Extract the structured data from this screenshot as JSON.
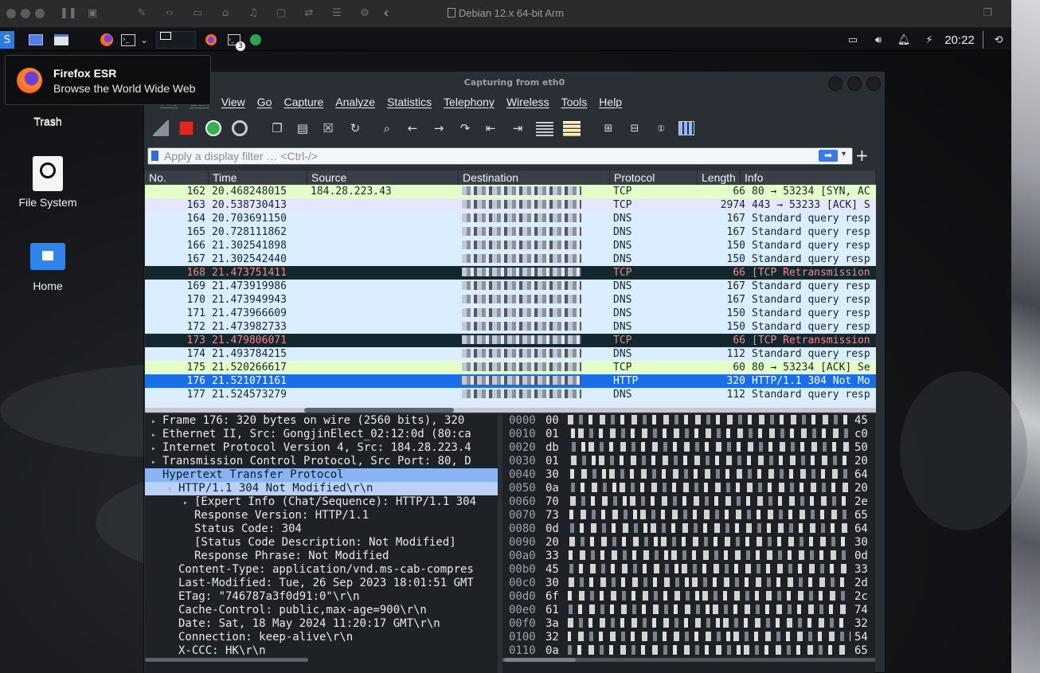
{
  "vm": {
    "title": "Debian 12.x 64-bit Arm"
  },
  "panel": {
    "clock": "20:22",
    "badge_count": "3"
  },
  "tooltip": {
    "title": "Firefox ESR",
    "subtitle": "Browse the World Wide Web"
  },
  "desktop": {
    "icons": [
      {
        "label": "Trash"
      },
      {
        "label": "File System"
      },
      {
        "label": "Home"
      }
    ]
  },
  "wireshark": {
    "title": "Capturing from eth0",
    "menu": [
      "File",
      "Edit",
      "View",
      "Go",
      "Capture",
      "Analyze",
      "Statistics",
      "Telephony",
      "Wireless",
      "Tools",
      "Help"
    ],
    "filter_placeholder": "Apply a display filter … <Ctrl-/>",
    "columns": [
      "No.",
      "Time",
      "Source",
      "Destination",
      "Protocol",
      "Length",
      "Info"
    ],
    "packets": [
      {
        "no": "162",
        "time": "20.468248015",
        "src": "184.28.223.43",
        "proto": "TCP",
        "len": "66",
        "info": "80 → 53234 [SYN, AC",
        "style": "tcp"
      },
      {
        "no": "163",
        "time": "20.538730413",
        "src": "",
        "proto": "TCP",
        "len": "2974",
        "info": "443 → 53233 [ACK] S",
        "style": "tcp2"
      },
      {
        "no": "164",
        "time": "20.703691150",
        "src": "",
        "proto": "DNS",
        "len": "167",
        "info": "Standard query resp",
        "style": "dns"
      },
      {
        "no": "165",
        "time": "20.728111862",
        "src": "",
        "proto": "DNS",
        "len": "167",
        "info": "Standard query resp",
        "style": "dns"
      },
      {
        "no": "166",
        "time": "21.302541898",
        "src": "",
        "proto": "DNS",
        "len": "150",
        "info": "Standard query resp",
        "style": "dns"
      },
      {
        "no": "167",
        "time": "21.302542440",
        "src": "",
        "proto": "DNS",
        "len": "150",
        "info": "Standard query resp",
        "style": "dns"
      },
      {
        "no": "168",
        "time": "21.473751411",
        "src": "",
        "proto": "TCP",
        "len": "66",
        "info": "[TCP Retransmission",
        "style": "retrans"
      },
      {
        "no": "169",
        "time": "21.473919986",
        "src": "",
        "proto": "DNS",
        "len": "167",
        "info": "Standard query resp",
        "style": "dns"
      },
      {
        "no": "170",
        "time": "21.473949943",
        "src": "",
        "proto": "DNS",
        "len": "167",
        "info": "Standard query resp",
        "style": "dns"
      },
      {
        "no": "171",
        "time": "21.473966609",
        "src": "",
        "proto": "DNS",
        "len": "150",
        "info": "Standard query resp",
        "style": "dns"
      },
      {
        "no": "172",
        "time": "21.473982733",
        "src": "",
        "proto": "DNS",
        "len": "150",
        "info": "Standard query resp",
        "style": "dns"
      },
      {
        "no": "173",
        "time": "21.479806071",
        "src": "",
        "proto": "TCP",
        "len": "66",
        "info": "[TCP Retransmission",
        "style": "retrans"
      },
      {
        "no": "174",
        "time": "21.493784215",
        "src": "",
        "proto": "DNS",
        "len": "112",
        "info": "Standard query resp",
        "style": "dns"
      },
      {
        "no": "175",
        "time": "21.520266617",
        "src": "",
        "proto": "TCP",
        "len": "60",
        "info": "80 → 53234 [ACK] Se",
        "style": "tcp"
      },
      {
        "no": "176",
        "time": "21.521071161",
        "src": "",
        "proto": "HTTP",
        "len": "320",
        "info": "HTTP/1.1 304 Not Mo",
        "style": "selected"
      },
      {
        "no": "177",
        "time": "21.524573279",
        "src": "",
        "proto": "DNS",
        "len": "112",
        "info": "Standard query resp",
        "style": "dns"
      }
    ],
    "details": [
      {
        "text": "Frame 176: 320 bytes on wire (2560 bits), 320",
        "indent": 0,
        "arrow": "▸",
        "style": ""
      },
      {
        "text": "Ethernet II, Src: GongjinElect_02:12:0d (80:ca",
        "indent": 0,
        "arrow": "▸",
        "style": ""
      },
      {
        "text": "Internet Protocol Version 4, Src: 184.28.223.4",
        "indent": 0,
        "arrow": "▸",
        "style": ""
      },
      {
        "text": "Transmission Control Protocol, Src Port: 80, D",
        "indent": 0,
        "arrow": "▸",
        "style": ""
      },
      {
        "text": "Hypertext Transfer Protocol",
        "indent": 0,
        "arrow": "▾",
        "style": "sel1"
      },
      {
        "text": "HTTP/1.1 304 Not Modified\\r\\n",
        "indent": 1,
        "arrow": "▾",
        "style": "sel2"
      },
      {
        "text": "[Expert Info (Chat/Sequence): HTTP/1.1 304",
        "indent": 2,
        "arrow": "▸",
        "style": ""
      },
      {
        "text": "Response Version: HTTP/1.1",
        "indent": 2,
        "arrow": "",
        "style": ""
      },
      {
        "text": "Status Code: 304",
        "indent": 2,
        "arrow": "",
        "style": ""
      },
      {
        "text": "[Status Code Description: Not Modified]",
        "indent": 2,
        "arrow": "",
        "style": ""
      },
      {
        "text": "Response Phrase: Not Modified",
        "indent": 2,
        "arrow": "",
        "style": ""
      },
      {
        "text": "Content-Type: application/vnd.ms-cab-compres",
        "indent": 1,
        "arrow": "",
        "style": ""
      },
      {
        "text": "Last-Modified: Tue, 26 Sep 2023 18:01:51 GMT",
        "indent": 1,
        "arrow": "",
        "style": ""
      },
      {
        "text": "ETag: \"746787a3f0d91:0\"\\r\\n",
        "indent": 1,
        "arrow": "",
        "style": ""
      },
      {
        "text": "Cache-Control: public,max-age=900\\r\\n",
        "indent": 1,
        "arrow": "",
        "style": ""
      },
      {
        "text": "Date: Sat, 18 May 2024 11:20:17 GMT\\r\\n",
        "indent": 1,
        "arrow": "",
        "style": ""
      },
      {
        "text": "Connection: keep-alive\\r\\n",
        "indent": 1,
        "arrow": "",
        "style": ""
      },
      {
        "text": "X-CCC: HK\\r\\n",
        "indent": 1,
        "arrow": "",
        "style": ""
      }
    ],
    "bytes": [
      {
        "off": "0000",
        "first": "00",
        "last": "45"
      },
      {
        "off": "0010",
        "first": "01",
        "last": "c0"
      },
      {
        "off": "0020",
        "first": "db",
        "last": "50"
      },
      {
        "off": "0030",
        "first": "01",
        "last": "20"
      },
      {
        "off": "0040",
        "first": "30",
        "last": "64"
      },
      {
        "off": "0050",
        "first": "0a",
        "last": "20"
      },
      {
        "off": "0060",
        "first": "70",
        "last": "2e"
      },
      {
        "off": "0070",
        "first": "73",
        "last": "65"
      },
      {
        "off": "0080",
        "first": "0d",
        "last": "64"
      },
      {
        "off": "0090",
        "first": "20",
        "last": "30"
      },
      {
        "off": "00a0",
        "first": "33",
        "last": "0d"
      },
      {
        "off": "00b0",
        "first": "45",
        "last": "33"
      },
      {
        "off": "00c0",
        "first": "30",
        "last": "2d"
      },
      {
        "off": "00d0",
        "first": "6f",
        "last": "2c"
      },
      {
        "off": "00e0",
        "first": "61",
        "last": "74"
      },
      {
        "off": "00f0",
        "first": "3a",
        "last": "32"
      },
      {
        "off": "0100",
        "first": "32",
        "last": "54"
      },
      {
        "off": "0110",
        "first": "0a",
        "last": "65"
      }
    ]
  }
}
